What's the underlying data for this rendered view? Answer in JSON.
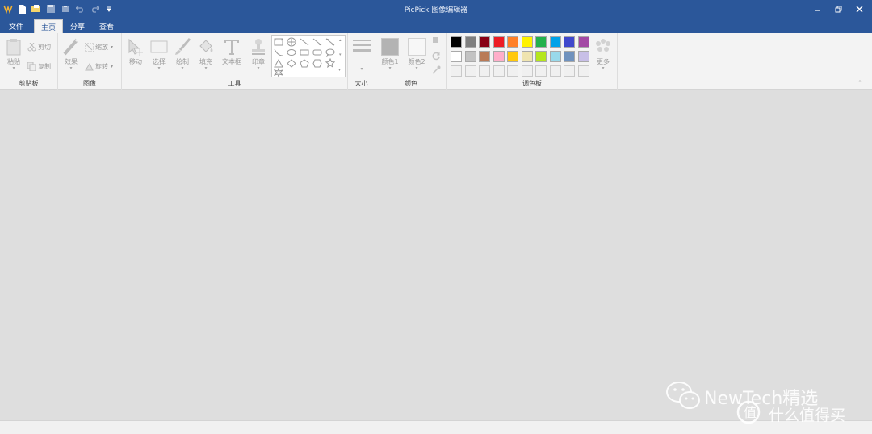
{
  "window": {
    "title": "PicPick 图像编辑器",
    "accent_color": "#2b579a"
  },
  "quick_access": [
    "app-logo-icon",
    "new-file-icon",
    "open-file-icon",
    "save-icon",
    "save-all-icon",
    "undo-icon",
    "redo-icon",
    "customize-icon"
  ],
  "tabs": [
    {
      "label": "文件"
    },
    {
      "label": "主页"
    },
    {
      "label": "分享"
    },
    {
      "label": "查看"
    }
  ],
  "active_tab": "主页",
  "groups": {
    "clipboard": {
      "label": "剪贴板",
      "paste": "粘贴",
      "cut": "剪切",
      "copy": "复制"
    },
    "image": {
      "label": "图像",
      "effect": "效果",
      "resize": "缩放",
      "rotate": "旋转"
    },
    "tools": {
      "label": "工具",
      "move": "移动",
      "select": "选择",
      "draw": "绘制",
      "fill": "填充",
      "textbox": "文本框",
      "stamp": "印章"
    },
    "size": {
      "label": "大小"
    },
    "color": {
      "label": "颜色",
      "color1": "颜色1",
      "color2": "颜色2"
    },
    "palette": {
      "label": "调色板",
      "more": "更多"
    }
  },
  "palette_colors": {
    "row1": [
      "#000000",
      "#7f7f7f",
      "#880015",
      "#ed1c24",
      "#ff7f27",
      "#fff200",
      "#22b14c",
      "#00a2e8",
      "#3f48cc",
      "#a349a4"
    ],
    "row2": [
      "#ffffff",
      "#c3c3c3",
      "#b97a57",
      "#ffaec9",
      "#ffc90e",
      "#efe4b0",
      "#b5e61d",
      "#99d9ea",
      "#7092be",
      "#c8bfe7"
    ]
  },
  "watermark": {
    "text": "NewTech精选",
    "sub": "什么值得买"
  }
}
